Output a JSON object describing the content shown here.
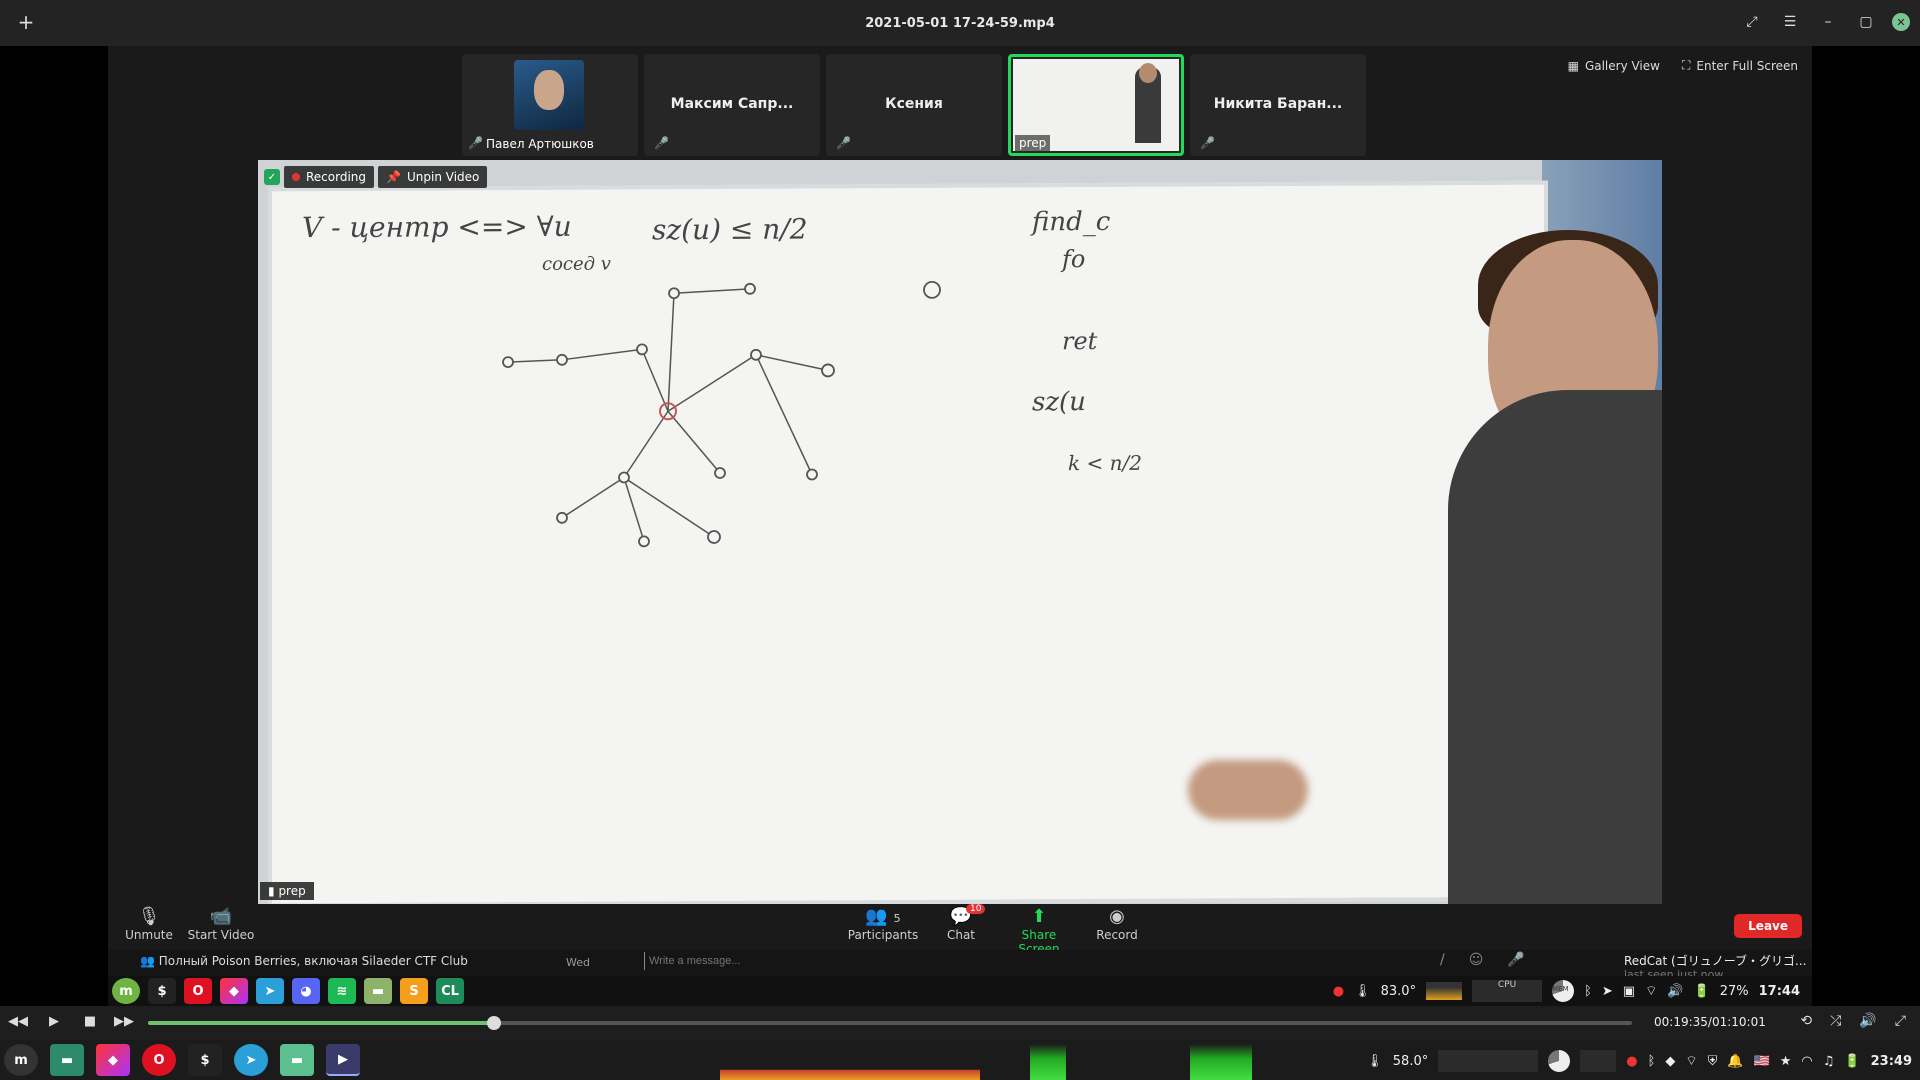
{
  "window": {
    "title": "2021-05-01 17-24-59.mp4",
    "new_tab_icon": "plus-icon",
    "buttons": [
      "expand-icon",
      "menu-icon",
      "minimize-icon",
      "maximize-icon",
      "close-icon"
    ]
  },
  "zoom": {
    "participants": [
      {
        "name": "Павел Артюшков",
        "muted": true,
        "has_avatar": true
      },
      {
        "name": "Максим Сапр...",
        "muted": true
      },
      {
        "name": "Ксения",
        "muted": true
      },
      {
        "name": "prep",
        "active": true,
        "video": true
      },
      {
        "name": "Никита Баран...",
        "muted": true
      }
    ],
    "view_buttons": {
      "gallery": "Gallery View",
      "fullscreen": "Enter Full Screen"
    },
    "main_video": {
      "recording_label": "Recording",
      "unpin_label": "Unpin Video",
      "name_tag": "prep",
      "board_text": {
        "line1": "V - центр <=> ∀u",
        "line1b": "сосед v",
        "formula": "sz(u) ≤ n/2",
        "right1": "find_c",
        "right2": "fo",
        "right3": "ret",
        "right4": "sz(u",
        "right5": "k < n/2"
      }
    },
    "toolbar": {
      "unmute": "Unmute",
      "start_video": "Start Video",
      "participants": "Participants",
      "participants_count": "5",
      "chat": "Chat",
      "chat_badge": "10",
      "share_screen": "Share Screen",
      "record": "Record",
      "leave": "Leave"
    },
    "chat_strip": {
      "channel": "Полный Poison Berries, включая Silaeder CTF Club",
      "day": "Wed",
      "placeholder": "Write a message...",
      "user": "RedCat (ゴリュノーブ・グリゴ...",
      "last_seen": "last seen just now"
    }
  },
  "inner_taskbar": {
    "temp": "83.0°",
    "cpu_label": "CPU",
    "mem_label": "MEM",
    "battery": "27%",
    "clock": "17:44"
  },
  "player": {
    "time": "00:19:35/01:10:01",
    "progress": 0.233
  },
  "os_taskbar": {
    "temp": "58.0°",
    "clock": "23:49"
  },
  "colors": {
    "accent_green": "#23d959",
    "leave_red": "#e02828"
  }
}
